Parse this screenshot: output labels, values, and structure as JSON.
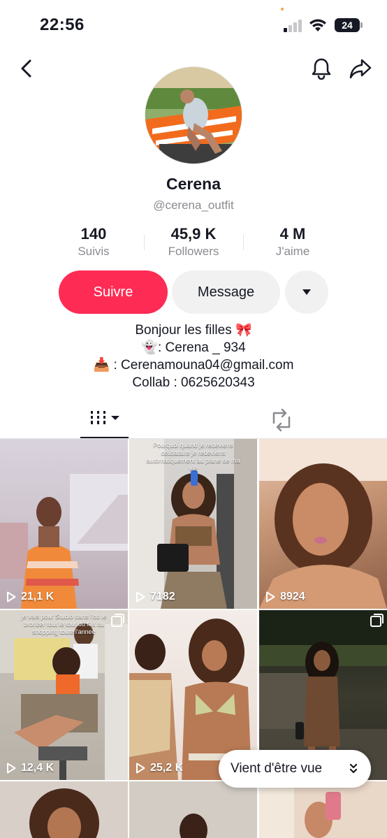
{
  "status_bar": {
    "time": "22:56",
    "battery": "24"
  },
  "profile": {
    "display_name": "Cerena",
    "username": "@cerena_outfit"
  },
  "stats": [
    {
      "value": "140",
      "label": "Suivis"
    },
    {
      "value": "45,9 K",
      "label": "Followers"
    },
    {
      "value": "4 M",
      "label": "J'aime"
    }
  ],
  "actions": {
    "follow": "Suivre",
    "message": "Message"
  },
  "bio": {
    "line1": "Bonjour les filles 🎀",
    "line2": "👻: Cerena _ 934",
    "line3": "📥 : Cerenamouna04@gmail.com",
    "line4": "Collab : 0625620343"
  },
  "tabs": {
    "videos_icon": "grid-icon",
    "repost_icon": "repost-icon"
  },
  "videos": [
    {
      "views": "21,1 K",
      "overlay": ""
    },
    {
      "views": "7182",
      "overlay": "Pourquoi quand je redeviens celibataire je redeviens automatiquement au plane de ma vie"
    },
    {
      "views": "8924",
      "overlay": ""
    },
    {
      "views": "12,4 K",
      "overlay": "je vais pour Studio dans l'ob le bronzer tout le tour du fait du shopping toute l'annee"
    },
    {
      "views": "25,2 K",
      "overlay": ""
    },
    {
      "views": "",
      "overlay": ""
    },
    {
      "views": "",
      "overlay": ""
    },
    {
      "views": "",
      "overlay": ""
    },
    {
      "views": "",
      "overlay": ""
    }
  ],
  "viewed_pill": "Vient d'être vue",
  "colors": {
    "primary": "#fe2c55",
    "secondary_bg": "#f1f1f2",
    "text": "#161823",
    "muted": "#8a8b91"
  }
}
